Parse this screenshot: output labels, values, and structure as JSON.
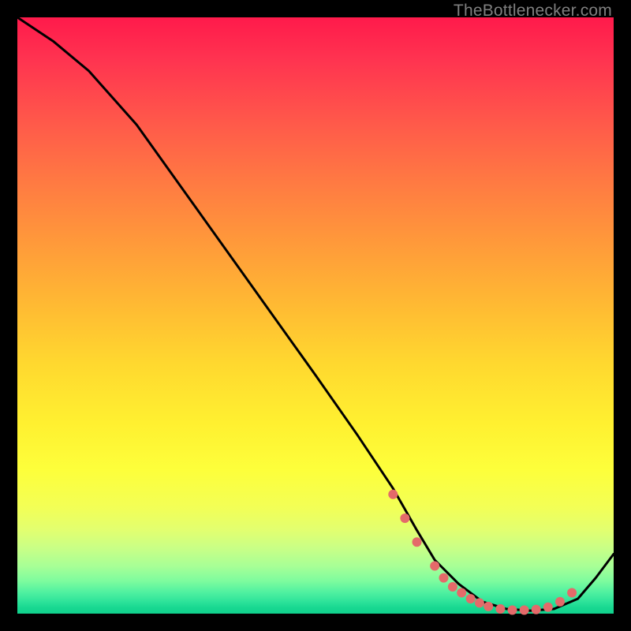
{
  "watermark": "TheBottlenecker.com",
  "colors": {
    "page_bg": "#000000",
    "gradient_top": "#ff1a4b",
    "gradient_bottom": "#10d08c",
    "line": "#000000",
    "dot": "#e46a6a"
  },
  "chart_data": {
    "type": "line",
    "title": "",
    "xlabel": "",
    "ylabel": "",
    "xlim": [
      0,
      100
    ],
    "ylim": [
      0,
      100
    ],
    "series": [
      {
        "name": "curve",
        "x": [
          0,
          6,
          12,
          20,
          30,
          40,
          50,
          57,
          63,
          67,
          70,
          74,
          78,
          82,
          86,
          90,
          94,
          97,
          100
        ],
        "y": [
          100,
          96,
          91,
          82,
          68,
          54,
          40,
          30,
          21,
          14,
          9,
          5,
          2,
          0.8,
          0.5,
          0.8,
          2.5,
          6,
          10
        ]
      }
    ],
    "markers": {
      "name": "highlight-dots",
      "x": [
        63,
        65,
        67,
        70,
        71.5,
        73,
        74.5,
        76,
        77.5,
        79,
        81,
        83,
        85,
        87,
        89,
        91,
        93
      ],
      "y": [
        20,
        16,
        12,
        8,
        6,
        4.5,
        3.5,
        2.5,
        1.8,
        1.2,
        0.8,
        0.6,
        0.6,
        0.7,
        1.1,
        2.0,
        3.5
      ]
    }
  }
}
